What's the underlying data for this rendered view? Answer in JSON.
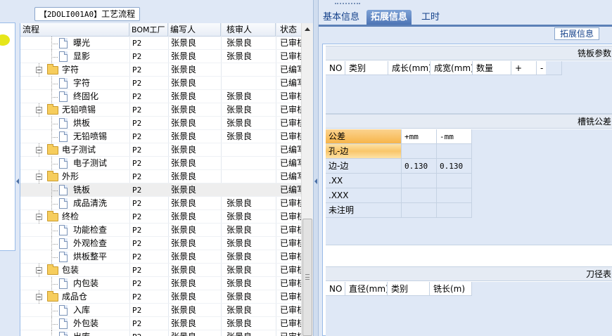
{
  "legend": {
    "code": "【2DOLI001A0】",
    "label": "工艺流程"
  },
  "grid": {
    "columns": [
      "流程",
      "BOM工厂",
      "编写人",
      "核审人",
      "状态"
    ],
    "rows": [
      {
        "name": "曝光",
        "level": 2,
        "type": "doc",
        "bom": "P2",
        "writer": "张景良",
        "reviewer": "张景良",
        "status": "已审核"
      },
      {
        "name": "显影",
        "level": 2,
        "type": "doc",
        "bom": "P2",
        "writer": "张景良",
        "reviewer": "张景良",
        "status": "已审核"
      },
      {
        "name": "字符",
        "level": 1,
        "type": "folder",
        "bom": "P2",
        "writer": "张景良",
        "reviewer": "",
        "status": "已编写"
      },
      {
        "name": "字符",
        "level": 2,
        "type": "doc",
        "bom": "P2",
        "writer": "张景良",
        "reviewer": "",
        "status": "已编写"
      },
      {
        "name": "终固化",
        "level": 2,
        "type": "doc",
        "bom": "P2",
        "writer": "张景良",
        "reviewer": "张景良",
        "status": "已审核"
      },
      {
        "name": "无铅喷锡",
        "level": 1,
        "type": "folder",
        "bom": "P2",
        "writer": "张景良",
        "reviewer": "张景良",
        "status": "已审核"
      },
      {
        "name": "烘板",
        "level": 2,
        "type": "doc",
        "bom": "P2",
        "writer": "张景良",
        "reviewer": "张景良",
        "status": "已审核"
      },
      {
        "name": "无铅喷锡",
        "level": 2,
        "type": "doc",
        "bom": "P2",
        "writer": "张景良",
        "reviewer": "张景良",
        "status": "已审核"
      },
      {
        "name": "电子测试",
        "level": 1,
        "type": "folder",
        "bom": "P2",
        "writer": "张景良",
        "reviewer": "",
        "status": "已编写"
      },
      {
        "name": "电子测试",
        "level": 2,
        "type": "doc",
        "bom": "P2",
        "writer": "张景良",
        "reviewer": "",
        "status": "已编写"
      },
      {
        "name": "外形",
        "level": 1,
        "type": "folder",
        "bom": "P2",
        "writer": "张景良",
        "reviewer": "",
        "status": "已编写"
      },
      {
        "name": "铣板",
        "level": 2,
        "type": "doc",
        "bom": "P2",
        "writer": "张景良",
        "reviewer": "",
        "status": "已编写",
        "selected": true
      },
      {
        "name": "成品清洗",
        "level": 2,
        "type": "doc",
        "bom": "P2",
        "writer": "张景良",
        "reviewer": "张景良",
        "status": "已审核"
      },
      {
        "name": "终检",
        "level": 1,
        "type": "folder",
        "bom": "P2",
        "writer": "张景良",
        "reviewer": "张景良",
        "status": "已审核"
      },
      {
        "name": "功能检查",
        "level": 2,
        "type": "doc",
        "bom": "P2",
        "writer": "张景良",
        "reviewer": "张景良",
        "status": "已审核"
      },
      {
        "name": "外观检查",
        "level": 2,
        "type": "doc",
        "bom": "P2",
        "writer": "张景良",
        "reviewer": "张景良",
        "status": "已审核"
      },
      {
        "name": "烘板整平",
        "level": 2,
        "type": "doc",
        "bom": "P2",
        "writer": "张景良",
        "reviewer": "张景良",
        "status": "已审核"
      },
      {
        "name": "包装",
        "level": 1,
        "type": "folder",
        "bom": "P2",
        "writer": "张景良",
        "reviewer": "张景良",
        "status": "已审核"
      },
      {
        "name": "内包装",
        "level": 2,
        "type": "doc",
        "bom": "P2",
        "writer": "张景良",
        "reviewer": "张景良",
        "status": "已审核"
      },
      {
        "name": "成品仓",
        "level": 1,
        "type": "folder",
        "bom": "P2",
        "writer": "张景良",
        "reviewer": "张景良",
        "status": "已审核"
      },
      {
        "name": "入库",
        "level": 2,
        "type": "doc",
        "bom": "P2",
        "writer": "张景良",
        "reviewer": "张景良",
        "status": "已审核"
      },
      {
        "name": "外包装",
        "level": 2,
        "type": "doc",
        "bom": "P2",
        "writer": "张景良",
        "reviewer": "张景良",
        "status": "已审核"
      },
      {
        "name": "出库",
        "level": 2,
        "type": "doc",
        "bom": "P2",
        "writer": "张景良",
        "reviewer": "张景良",
        "status": "已审核"
      }
    ]
  },
  "tabs": [
    {
      "label": "基本信息",
      "active": false
    },
    {
      "label": "拓展信息",
      "active": true
    },
    {
      "label": "工时",
      "active": false
    }
  ],
  "right": {
    "legend": "拓展信息",
    "milling": {
      "title": "铣板参数",
      "columns": [
        "NO",
        "类别",
        "成长(mm)",
        "成宽(mm)",
        "数量",
        "+",
        "-"
      ]
    },
    "tolerance": {
      "title": "槽铣公差",
      "headers": [
        "公差",
        "+mm",
        "-mm"
      ],
      "rows": [
        {
          "label": "孔-边",
          "plus": "",
          "minus": ""
        },
        {
          "label": "边-边",
          "plus": "0.130",
          "minus": "0.130"
        },
        {
          "label": ".XX",
          "plus": "",
          "minus": ""
        },
        {
          "label": ".XXX",
          "plus": "",
          "minus": ""
        },
        {
          "label": "未注明",
          "plus": "",
          "minus": ""
        }
      ]
    },
    "tools": {
      "title": "刀径表",
      "columns": [
        "NO",
        "直径(mm)",
        "类别",
        "铣长(m)"
      ]
    }
  }
}
